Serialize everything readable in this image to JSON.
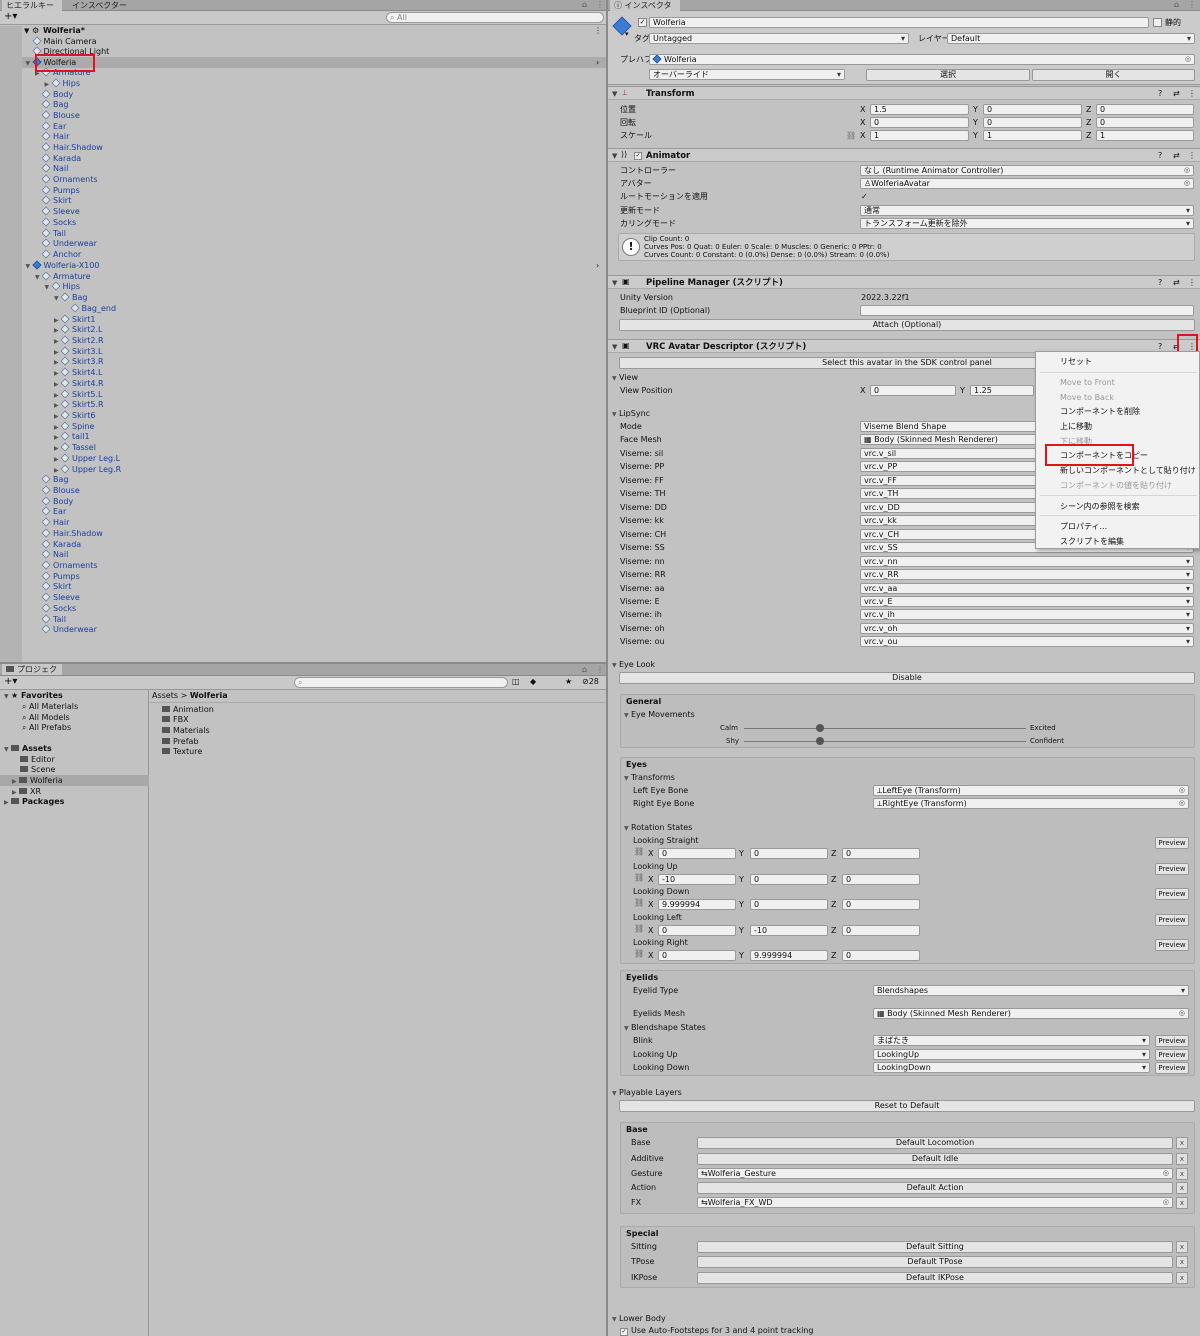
{
  "hierarchy": {
    "tabs": [
      "ヒエラルキー",
      "インスペクター"
    ],
    "search_placeholder": "All",
    "scene": "Wolferia*",
    "items": [
      {
        "label": "Main Camera",
        "indent": 1,
        "plain": true,
        "arrow": ""
      },
      {
        "label": "Directional Light",
        "indent": 1,
        "plain": true,
        "arrow": ""
      },
      {
        "label": "Wolferia",
        "indent": 1,
        "plain": true,
        "arrow": "▼",
        "selected": true,
        "blue": true
      },
      {
        "label": "Armature",
        "indent": 2,
        "arrow": "▶"
      },
      {
        "label": "Hips",
        "indent": 3,
        "arrow": "▶"
      },
      {
        "label": "Body",
        "indent": 2,
        "arrow": ""
      },
      {
        "label": "Bag",
        "indent": 2,
        "arrow": ""
      },
      {
        "label": "Blouse",
        "indent": 2,
        "arrow": ""
      },
      {
        "label": "Ear",
        "indent": 2,
        "arrow": ""
      },
      {
        "label": "Hair",
        "indent": 2,
        "arrow": ""
      },
      {
        "label": "Hair.Shadow",
        "indent": 2,
        "arrow": ""
      },
      {
        "label": "Karada",
        "indent": 2,
        "arrow": ""
      },
      {
        "label": "Nail",
        "indent": 2,
        "arrow": ""
      },
      {
        "label": "Ornaments",
        "indent": 2,
        "arrow": ""
      },
      {
        "label": "Pumps",
        "indent": 2,
        "arrow": ""
      },
      {
        "label": "Skirt",
        "indent": 2,
        "arrow": ""
      },
      {
        "label": "Sleeve",
        "indent": 2,
        "arrow": ""
      },
      {
        "label": "Socks",
        "indent": 2,
        "arrow": ""
      },
      {
        "label": "Tail",
        "indent": 2,
        "arrow": ""
      },
      {
        "label": "Underwear",
        "indent": 2,
        "arrow": ""
      },
      {
        "label": "Anchor",
        "indent": 2,
        "arrow": ""
      },
      {
        "label": "Wolferia-X100",
        "indent": 1,
        "arrow": "▼",
        "blue": true
      },
      {
        "label": "Armature",
        "indent": 2,
        "arrow": "▼"
      },
      {
        "label": "Hips",
        "indent": 3,
        "arrow": "▼"
      },
      {
        "label": "Bag",
        "indent": 4,
        "arrow": "▼"
      },
      {
        "label": "Bag_end",
        "indent": 5,
        "arrow": ""
      },
      {
        "label": "Skirt1",
        "indent": 4,
        "arrow": "▶"
      },
      {
        "label": "Skirt2.L",
        "indent": 4,
        "arrow": "▶"
      },
      {
        "label": "Skirt2.R",
        "indent": 4,
        "arrow": "▶"
      },
      {
        "label": "Skirt3.L",
        "indent": 4,
        "arrow": "▶"
      },
      {
        "label": "Skirt3.R",
        "indent": 4,
        "arrow": "▶"
      },
      {
        "label": "Skirt4.L",
        "indent": 4,
        "arrow": "▶"
      },
      {
        "label": "Skirt4.R",
        "indent": 4,
        "arrow": "▶"
      },
      {
        "label": "Skirt5.L",
        "indent": 4,
        "arrow": "▶"
      },
      {
        "label": "Skirt5.R",
        "indent": 4,
        "arrow": "▶"
      },
      {
        "label": "Skirt6",
        "indent": 4,
        "arrow": "▶"
      },
      {
        "label": "Spine",
        "indent": 4,
        "arrow": "▶"
      },
      {
        "label": "tail1",
        "indent": 4,
        "arrow": "▶"
      },
      {
        "label": "Tassel",
        "indent": 4,
        "arrow": "▶"
      },
      {
        "label": "Upper Leg.L",
        "indent": 4,
        "arrow": "▶"
      },
      {
        "label": "Upper Leg.R",
        "indent": 4,
        "arrow": "▶"
      },
      {
        "label": "Bag",
        "indent": 2,
        "arrow": ""
      },
      {
        "label": "Blouse",
        "indent": 2,
        "arrow": ""
      },
      {
        "label": "Body",
        "indent": 2,
        "arrow": ""
      },
      {
        "label": "Ear",
        "indent": 2,
        "arrow": ""
      },
      {
        "label": "Hair",
        "indent": 2,
        "arrow": ""
      },
      {
        "label": "Hair.Shadow",
        "indent": 2,
        "arrow": ""
      },
      {
        "label": "Karada",
        "indent": 2,
        "arrow": ""
      },
      {
        "label": "Nail",
        "indent": 2,
        "arrow": ""
      },
      {
        "label": "Ornaments",
        "indent": 2,
        "arrow": ""
      },
      {
        "label": "Pumps",
        "indent": 2,
        "arrow": ""
      },
      {
        "label": "Skirt",
        "indent": 2,
        "arrow": ""
      },
      {
        "label": "Sleeve",
        "indent": 2,
        "arrow": ""
      },
      {
        "label": "Socks",
        "indent": 2,
        "arrow": ""
      },
      {
        "label": "Tail",
        "indent": 2,
        "arrow": ""
      },
      {
        "label": "Underwear",
        "indent": 2,
        "arrow": ""
      }
    ]
  },
  "project": {
    "tab": "プロジェクト",
    "count": "28",
    "favorites": "Favorites",
    "fav_items": [
      "All Materials",
      "All Models",
      "All Prefabs"
    ],
    "assets": "Assets",
    "asset_items": [
      "Editor",
      "Scene",
      "Wolferia",
      "XR"
    ],
    "packages": "Packages",
    "breadcrumb_root": "Assets",
    "breadcrumb_current": "Wolferia",
    "folders": [
      "Animation",
      "FBX",
      "Materials",
      "Prefab",
      "Texture"
    ]
  },
  "inspector": {
    "tab": "インスペクター",
    "object_name": "Wolferia",
    "static_label": "静的",
    "tag_label": "タグ",
    "tag_value": "Untagged",
    "layer_label": "レイヤー",
    "layer_value": "Default",
    "prefab_label": "プレハブ",
    "prefab_value": "Wolferia",
    "override_label": "オーバーライド",
    "select_label": "選択",
    "open_label": "開く",
    "transform": {
      "title": "Transform",
      "rows": [
        {
          "label": "位置",
          "x": "1.5",
          "y": "0",
          "z": "0"
        },
        {
          "label": "回転",
          "x": "0",
          "y": "0",
          "z": "0"
        },
        {
          "label": "スケール",
          "x": "1",
          "y": "1",
          "z": "1"
        }
      ]
    },
    "animator": {
      "title": "Animator",
      "controller_label": "コントローラー",
      "controller_value": "なし (Runtime Animator Controller)",
      "avatar_label": "アバター",
      "avatar_value": "WolferiaAvatar",
      "root_motion_label": "ルートモーションを適用",
      "update_label": "更新モード",
      "update_value": "通常",
      "culling_label": "カリングモード",
      "culling_value": "トランスフォーム更新を除外",
      "info": [
        "Clip Count: 0",
        "Curves Pos: 0 Quat: 0 Euler: 0 Scale: 0 Muscles: 0 Generic: 0 PPtr: 0",
        "Curves Count: 0 Constant: 0 (0.0%) Dense: 0 (0.0%) Stream: 0 (0.0%)"
      ]
    },
    "pipeline": {
      "title": "Pipeline Manager (スクリプト)",
      "unity_version_label": "Unity Version",
      "unity_version_value": "2022.3.22f1",
      "blueprint_label": "Blueprint ID (Optional)",
      "attach_label": "Attach (Optional)"
    },
    "descriptor": {
      "title": "VRC Avatar Descriptor (スクリプト)",
      "select_sdk": "Select this avatar in the SDK control panel",
      "view_section": "View",
      "view_position_label": "View Position",
      "view_x": "0",
      "view_y": "1.25",
      "lipsync_section": "LipSync",
      "mode_label": "Mode",
      "mode_value": "Viseme Blend Shape",
      "face_mesh_label": "Face Mesh",
      "face_mesh_value": "Body (Skinned Mesh Renderer)",
      "visemes": [
        {
          "label": "Viseme: sil",
          "value": "vrc.v_sil"
        },
        {
          "label": "Viseme: PP",
          "value": "vrc.v_PP"
        },
        {
          "label": "Viseme: FF",
          "value": "vrc.v_FF"
        },
        {
          "label": "Viseme: TH",
          "value": "vrc.v_TH"
        },
        {
          "label": "Viseme: DD",
          "value": "vrc.v_DD"
        },
        {
          "label": "Viseme: kk",
          "value": "vrc.v_kk"
        },
        {
          "label": "Viseme: CH",
          "value": "vrc.v_CH"
        },
        {
          "label": "Viseme: SS",
          "value": "vrc.v_SS"
        },
        {
          "label": "Viseme: nn",
          "value": "vrc.v_nn"
        },
        {
          "label": "Viseme: RR",
          "value": "vrc.v_RR"
        },
        {
          "label": "Viseme: aa",
          "value": "vrc.v_aa"
        },
        {
          "label": "Viseme: E",
          "value": "vrc.v_E"
        },
        {
          "label": "Viseme: ih",
          "value": "vrc.v_ih"
        },
        {
          "label": "Viseme: oh",
          "value": "vrc.v_oh"
        },
        {
          "label": "Viseme: ou",
          "value": "vrc.v_ou"
        }
      ],
      "eyelook_section": "Eye Look",
      "disable_label": "Disable",
      "general_label": "General",
      "eye_movements_label": "Eye Movements",
      "calm": "Calm",
      "excited": "Excited",
      "shy": "Shy",
      "confident": "Confident",
      "slider_calm_excited": 0.27,
      "slider_shy_confident": 0.27,
      "eyes_label": "Eyes",
      "transforms_label": "Transforms",
      "left_eye_label": "Left Eye Bone",
      "left_eye_value": "LeftEye (Transform)",
      "right_eye_label": "Right Eye Bone",
      "right_eye_value": "RightEye (Transform)",
      "rotation_states_label": "Rotation States",
      "preview_label": "Preview",
      "rotations": [
        {
          "label": "Looking Straight",
          "x": "0",
          "y": "0",
          "z": "0"
        },
        {
          "label": "Looking Up",
          "x": "-10",
          "y": "0",
          "z": "0"
        },
        {
          "label": "Looking Down",
          "x": "9.999994",
          "y": "0",
          "z": "0"
        },
        {
          "label": "Looking Left",
          "x": "0",
          "y": "-10",
          "z": "0"
        },
        {
          "label": "Looking Right",
          "x": "0",
          "y": "9.999994",
          "z": "0"
        }
      ],
      "eyelids_label": "Eyelids",
      "eyelid_type_label": "Eyelid Type",
      "eyelid_type_value": "Blendshapes",
      "eyelids_mesh_label": "Eyelids Mesh",
      "eyelids_mesh_value": "Body (Skinned Mesh Renderer)",
      "blendshape_states_label": "Blendshape States",
      "blendshapes": [
        {
          "label": "Blink",
          "value": "まばたき"
        },
        {
          "label": "Looking Up",
          "value": "LookingUp"
        },
        {
          "label": "Looking Down",
          "value": "LookingDown"
        }
      ],
      "playable_layers_section": "Playable Layers",
      "reset_label": "Reset to Default",
      "base_label": "Base",
      "base_layers": [
        {
          "label": "Base",
          "value": "Default Locomotion",
          "obj": false
        },
        {
          "label": "Additive",
          "value": "Default Idle",
          "obj": false
        },
        {
          "label": "Gesture",
          "value": "Wolferia_Gesture",
          "obj": true
        },
        {
          "label": "Action",
          "value": "Default Action",
          "obj": false
        },
        {
          "label": "FX",
          "value": "Wolferia_FX_WD",
          "obj": true
        }
      ],
      "special_label": "Special",
      "special_layers": [
        {
          "label": "Sitting",
          "value": "Default Sitting"
        },
        {
          "label": "TPose",
          "value": "Default TPose"
        },
        {
          "label": "IKPose",
          "value": "Default IKPose"
        }
      ],
      "lower_body_section": "Lower Body",
      "auto_footsteps_label": "Use Auto-Footsteps for 3 and 4 point tracking"
    },
    "context_menu": [
      {
        "label": "リセット",
        "disabled": false
      },
      {
        "label": "Move to Front",
        "disabled": true
      },
      {
        "label": "Move to Back",
        "disabled": true
      },
      {
        "label": "コンポーネントを削除",
        "disabled": false
      },
      {
        "label": "上に移動",
        "disabled": false
      },
      {
        "label": "下に移動",
        "disabled": true
      },
      {
        "label": "コンポーネントをコピー",
        "disabled": false
      },
      {
        "label": "新しいコンポーネントとして貼り付け",
        "disabled": false
      },
      {
        "label": "コンポーネントの値を貼り付け",
        "disabled": true
      },
      {
        "label": "シーン内の参照を検索",
        "disabled": false
      },
      {
        "label": "プロパティ...",
        "disabled": false
      },
      {
        "label": "スクリプトを編集",
        "disabled": false
      }
    ]
  }
}
